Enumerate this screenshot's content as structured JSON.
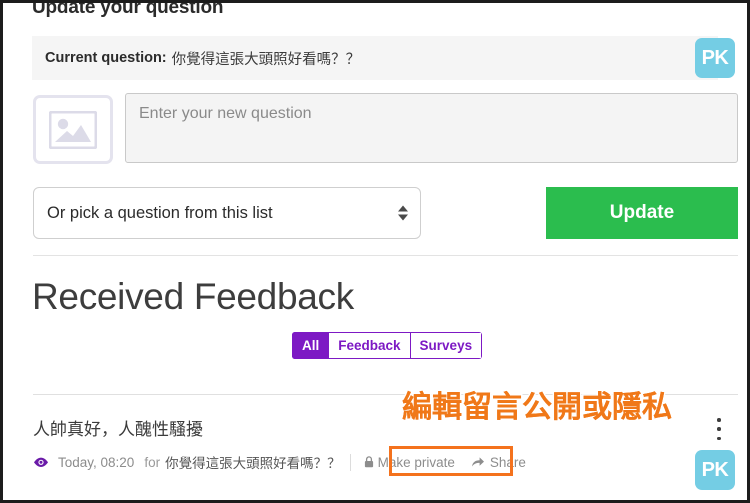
{
  "update_section": {
    "title": "Update your question",
    "current_question_label": "Current question:",
    "current_question_text": "你覺得這張大頭照好看嗎？？",
    "avatar_text": "PK",
    "image_placeholder_icon": "image-placeholder-icon",
    "new_question_placeholder": "Enter your new question",
    "new_question_value": "",
    "select_value": "Or pick a question from this list",
    "select_options": [
      "Or pick a question from this list"
    ],
    "update_button_label": "Update"
  },
  "feedback_section": {
    "heading": "Received Feedback",
    "tabs": [
      {
        "label": "All",
        "active": true
      },
      {
        "label": "Feedback",
        "active": false
      },
      {
        "label": "Surveys",
        "active": false
      }
    ],
    "items": [
      {
        "text": "人帥真好，人醜性騷擾",
        "visibility_icon": "eye-icon",
        "time": "Today, 08:20",
        "for_label": "for",
        "question": "你覺得這張大頭照好看嗎？？",
        "make_private_label": "Make private",
        "share_label": "Share",
        "avatar_text": "PK",
        "menu_icon": "kebab-menu-icon"
      }
    ]
  },
  "annotation": {
    "text": "編輯留言公開或隱私",
    "color": "#f07818",
    "highlight_color": "#f4721d"
  },
  "colors": {
    "accent_purple": "#7d19c4",
    "update_green": "#2bbd4e",
    "avatar_blue": "#74cde4",
    "bar_gray": "#f5f5f5"
  }
}
